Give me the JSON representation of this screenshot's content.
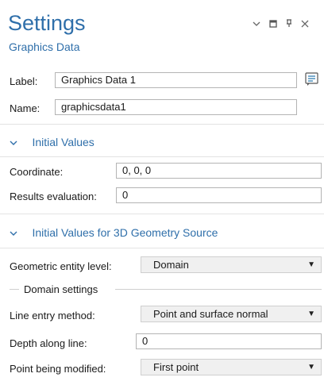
{
  "header": {
    "title": "Settings",
    "subtitle": "Graphics Data",
    "controls": {
      "collapse": "⌄",
      "maximize": "□",
      "pin": "ꟸ",
      "close": "×"
    }
  },
  "identity": {
    "label_caption": "Label:",
    "label_value": "Graphics Data 1",
    "name_caption": "Name:",
    "name_value": "graphicsdata1",
    "label_icon": "edit-label-icon"
  },
  "initial_values": {
    "title": "Initial Values",
    "coordinate_caption": "Coordinate:",
    "coordinate_value": "0, 0, 0",
    "results_caption": "Results evaluation:",
    "results_value": "0"
  },
  "geometry_source": {
    "title": "Initial Values for 3D Geometry Source",
    "entity_level_caption": "Geometric entity level:",
    "entity_level_value": "Domain",
    "domain_settings_title": "Domain settings",
    "line_entry_caption": "Line entry method:",
    "line_entry_value": "Point and surface normal",
    "depth_caption": "Depth along line:",
    "depth_value": "0",
    "point_modified_caption": "Point being modified:",
    "point_modified_value": "First point"
  },
  "colors": {
    "accent": "#2f6faa",
    "field_border": "#b4b4b4",
    "select_bg": "#f0f0f0"
  }
}
